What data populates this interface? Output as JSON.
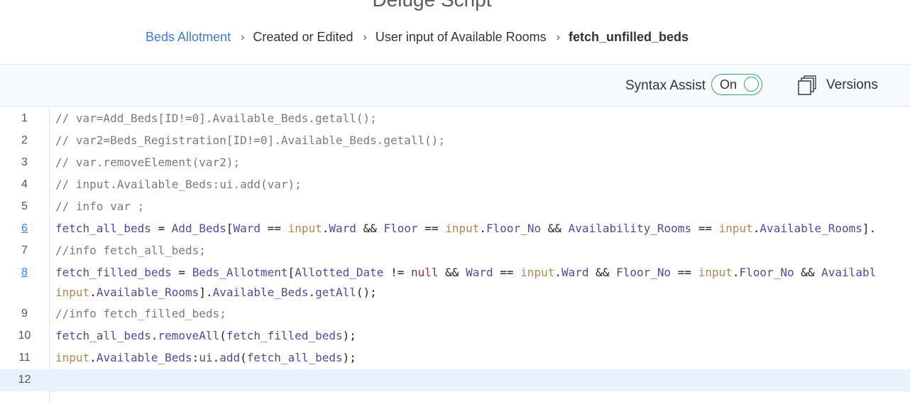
{
  "page": {
    "title": "Deluge Script",
    "breadcrumb": [
      "Beds Allotment",
      "Created or Edited",
      "User input of Available Rooms",
      "fetch_unfilled_beds"
    ],
    "breadcrumb_separator": "›"
  },
  "toolbar": {
    "syntax_assist_label": "Syntax Assist",
    "toggle_state": "On",
    "versions_label": "Versions",
    "versions_icon": "copy-stack-icon"
  },
  "editor": {
    "line_numbers": [
      "1",
      "2",
      "3",
      "4",
      "5",
      "6",
      "7",
      "8",
      "9",
      "10",
      "11",
      "12"
    ],
    "linked_line_numbers": [
      "6",
      "8"
    ],
    "active_line": "12",
    "lines": [
      "// var=Add_Beds[ID!=0].Available_Beds.getall();",
      "// var2=Beds_Registration[ID!=0].Available_Beds.getall();",
      "// var.removeElement(var2);",
      "// input.Available_Beds:ui.add(var);",
      "// info var ;",
      "fetch_all_beds = Add_Beds[Ward == input.Ward && Floor == input.Floor_No && Availability_Rooms == input.Available_Rooms].",
      "//info fetch_all_beds;",
      "fetch_filled_beds = Beds_Allotment[Allotted_Date != null && Ward == input.Ward && Floor_No == input.Floor_No && Availabl\ninput.Available_Rooms].Available_Beds.getAll();",
      "//info fetch_filled_beds;",
      "fetch_all_beds.removeAll(fetch_filled_beds);",
      "input.Available_Beds:ui.add(fetch_all_beds);",
      ""
    ]
  },
  "colors": {
    "link": "#3b7dd8",
    "toggle_green": "#2aa66a",
    "toolbar_bg": "#f6f9fd",
    "active_line_bg": "#e8f1fd"
  }
}
